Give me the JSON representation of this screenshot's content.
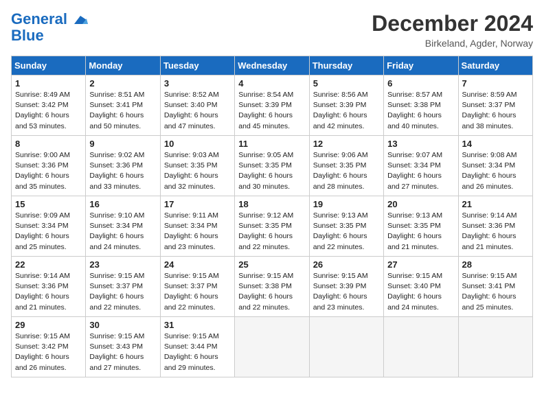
{
  "logo": {
    "line1": "General",
    "line2": "Blue"
  },
  "title": "December 2024",
  "subtitle": "Birkeland, Agder, Norway",
  "days_of_week": [
    "Sunday",
    "Monday",
    "Tuesday",
    "Wednesday",
    "Thursday",
    "Friday",
    "Saturday"
  ],
  "weeks": [
    [
      {
        "day": "1",
        "rise": "8:49 AM",
        "set": "3:42 PM",
        "daylight": "6 hours and 53 minutes."
      },
      {
        "day": "2",
        "rise": "8:51 AM",
        "set": "3:41 PM",
        "daylight": "6 hours and 50 minutes."
      },
      {
        "day": "3",
        "rise": "8:52 AM",
        "set": "3:40 PM",
        "daylight": "6 hours and 47 minutes."
      },
      {
        "day": "4",
        "rise": "8:54 AM",
        "set": "3:39 PM",
        "daylight": "6 hours and 45 minutes."
      },
      {
        "day": "5",
        "rise": "8:56 AM",
        "set": "3:39 PM",
        "daylight": "6 hours and 42 minutes."
      },
      {
        "day": "6",
        "rise": "8:57 AM",
        "set": "3:38 PM",
        "daylight": "6 hours and 40 minutes."
      },
      {
        "day": "7",
        "rise": "8:59 AM",
        "set": "3:37 PM",
        "daylight": "6 hours and 38 minutes."
      }
    ],
    [
      {
        "day": "8",
        "rise": "9:00 AM",
        "set": "3:36 PM",
        "daylight": "6 hours and 35 minutes."
      },
      {
        "day": "9",
        "rise": "9:02 AM",
        "set": "3:36 PM",
        "daylight": "6 hours and 33 minutes."
      },
      {
        "day": "10",
        "rise": "9:03 AM",
        "set": "3:35 PM",
        "daylight": "6 hours and 32 minutes."
      },
      {
        "day": "11",
        "rise": "9:05 AM",
        "set": "3:35 PM",
        "daylight": "6 hours and 30 minutes."
      },
      {
        "day": "12",
        "rise": "9:06 AM",
        "set": "3:35 PM",
        "daylight": "6 hours and 28 minutes."
      },
      {
        "day": "13",
        "rise": "9:07 AM",
        "set": "3:34 PM",
        "daylight": "6 hours and 27 minutes."
      },
      {
        "day": "14",
        "rise": "9:08 AM",
        "set": "3:34 PM",
        "daylight": "6 hours and 26 minutes."
      }
    ],
    [
      {
        "day": "15",
        "rise": "9:09 AM",
        "set": "3:34 PM",
        "daylight": "6 hours and 25 minutes."
      },
      {
        "day": "16",
        "rise": "9:10 AM",
        "set": "3:34 PM",
        "daylight": "6 hours and 24 minutes."
      },
      {
        "day": "17",
        "rise": "9:11 AM",
        "set": "3:34 PM",
        "daylight": "6 hours and 23 minutes."
      },
      {
        "day": "18",
        "rise": "9:12 AM",
        "set": "3:35 PM",
        "daylight": "6 hours and 22 minutes."
      },
      {
        "day": "19",
        "rise": "9:13 AM",
        "set": "3:35 PM",
        "daylight": "6 hours and 22 minutes."
      },
      {
        "day": "20",
        "rise": "9:13 AM",
        "set": "3:35 PM",
        "daylight": "6 hours and 21 minutes."
      },
      {
        "day": "21",
        "rise": "9:14 AM",
        "set": "3:36 PM",
        "daylight": "6 hours and 21 minutes."
      }
    ],
    [
      {
        "day": "22",
        "rise": "9:14 AM",
        "set": "3:36 PM",
        "daylight": "6 hours and 21 minutes."
      },
      {
        "day": "23",
        "rise": "9:15 AM",
        "set": "3:37 PM",
        "daylight": "6 hours and 22 minutes."
      },
      {
        "day": "24",
        "rise": "9:15 AM",
        "set": "3:37 PM",
        "daylight": "6 hours and 22 minutes."
      },
      {
        "day": "25",
        "rise": "9:15 AM",
        "set": "3:38 PM",
        "daylight": "6 hours and 22 minutes."
      },
      {
        "day": "26",
        "rise": "9:15 AM",
        "set": "3:39 PM",
        "daylight": "6 hours and 23 minutes."
      },
      {
        "day": "27",
        "rise": "9:15 AM",
        "set": "3:40 PM",
        "daylight": "6 hours and 24 minutes."
      },
      {
        "day": "28",
        "rise": "9:15 AM",
        "set": "3:41 PM",
        "daylight": "6 hours and 25 minutes."
      }
    ],
    [
      {
        "day": "29",
        "rise": "9:15 AM",
        "set": "3:42 PM",
        "daylight": "6 hours and 26 minutes."
      },
      {
        "day": "30",
        "rise": "9:15 AM",
        "set": "3:43 PM",
        "daylight": "6 hours and 27 minutes."
      },
      {
        "day": "31",
        "rise": "9:15 AM",
        "set": "3:44 PM",
        "daylight": "6 hours and 29 minutes."
      },
      null,
      null,
      null,
      null
    ]
  ]
}
